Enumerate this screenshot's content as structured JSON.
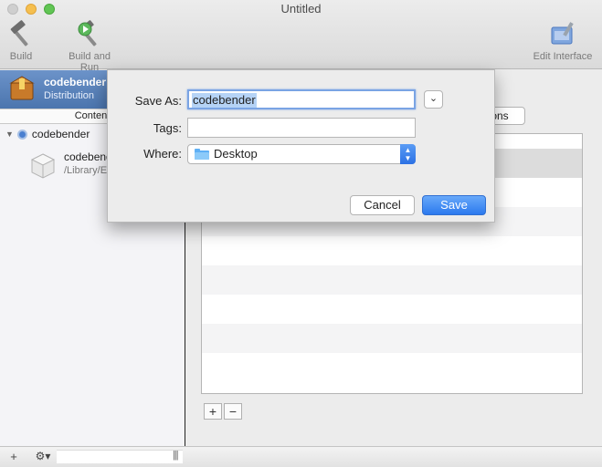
{
  "window": {
    "title": "Untitled"
  },
  "toolbar": {
    "build_label": "Build",
    "build_run_label": "Build and Run",
    "edit_interface_label": "Edit Interface"
  },
  "sidebar": {
    "project_name": "codebender",
    "project_subtitle": "Distribution",
    "content_tab": "Content",
    "tree_root": "codebender",
    "package_name": "codebender",
    "package_path": "/Library/E"
  },
  "main": {
    "options_button": "ons",
    "add_label": "+",
    "remove_label": "−"
  },
  "bottombar": {
    "add_label": "+",
    "gear_label": "⚙▾",
    "grip": "|||"
  },
  "save_dialog": {
    "save_as_label": "Save As:",
    "save_as_value": "codebender",
    "tags_label": "Tags:",
    "tags_value": "",
    "where_label": "Where:",
    "where_value": "Desktop",
    "expand_icon": "⌄",
    "cancel_label": "Cancel",
    "save_label": "Save"
  },
  "colors": {
    "accent": "#2b79ee",
    "selection": "#b5d3f6",
    "sidebar_header": "#5a82bb"
  }
}
